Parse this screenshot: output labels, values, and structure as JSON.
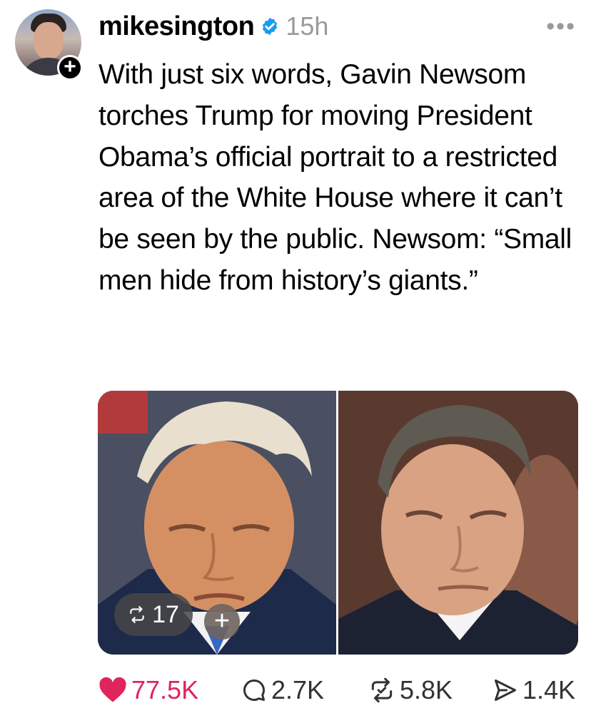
{
  "post": {
    "username": "mikesington",
    "time": "15h",
    "more": "•••",
    "follow": "+",
    "text": "With just six words, Gavin Newsom torches Trump for moving President Obama’s official portrait to a restricted area of the White House where it can’t be seen by the public. Newsom: “Small men hide from history’s giants.”"
  },
  "media": {
    "repost_count": "17",
    "add": "+"
  },
  "actions": {
    "likes": "77.5K",
    "replies": "2.7K",
    "reposts": "5.8K",
    "shares": "1.4K"
  },
  "colors": {
    "like": "#e0245e",
    "verified": "#1d9bf0",
    "muted": "#9a9a9a"
  },
  "icons": {
    "verified": "verified-badge-icon",
    "like": "heart-icon",
    "reply": "comment-icon",
    "repost": "repost-icon",
    "share": "share-icon"
  }
}
